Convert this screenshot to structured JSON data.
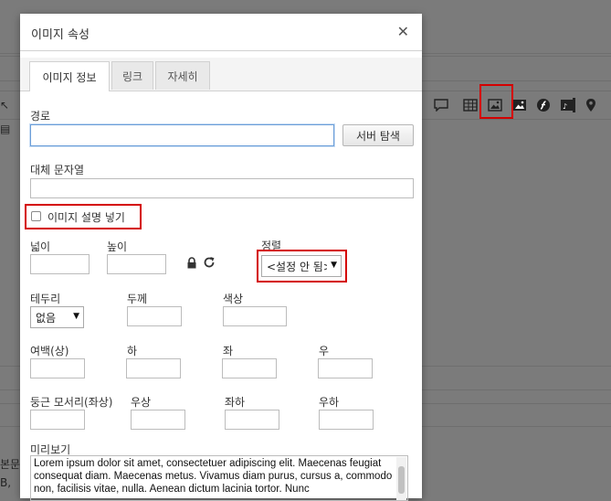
{
  "dialog": {
    "title": "이미지 속성",
    "close_label": "✕",
    "tabs": [
      {
        "label": "이미지 정보"
      },
      {
        "label": "링크"
      },
      {
        "label": "자세히"
      }
    ]
  },
  "form": {
    "path_label": "경로",
    "path_value": "",
    "browse_button": "서버 탐색",
    "alt_label": "대체 문자열",
    "alt_value": "",
    "caption_label": "이미지 설명 넣기",
    "width_label": "넓이",
    "height_label": "높이",
    "align_label": "정렬",
    "align_value": "<설정 안 됨>",
    "border_label": "테두리",
    "border_value": "없음",
    "thickness_label": "두께",
    "color_label": "색상",
    "margin_top_label": "여백(상)",
    "margin_bottom_label": "하",
    "margin_left_label": "좌",
    "margin_right_label": "우",
    "radius_tl_label": "둥근 모서리(좌상)",
    "radius_tr_label": "우상",
    "radius_bl_label": "좌하",
    "radius_br_label": "우하",
    "preview_label": "미리보기",
    "preview_text": "Lorem ipsum dolor sit amet, consectetuer adipiscing elit. Maecenas feugiat consequat diam. Maecenas metus. Vivamus diam purus, cursus a, commodo non, facilisis vitae, nulla. Aenean dictum lacinia tortor. Nunc"
  },
  "background": {
    "text_line1": "본문",
    "text_line2": "B,",
    "toolbar_icons": [
      "table-icon",
      "image-icon",
      "image2-icon",
      "flash-icon",
      "video-icon",
      "map-pin-icon"
    ]
  },
  "colors": {
    "highlight": "#d40000",
    "focus_border": "#6b9ed8",
    "overlay": "#7b7b7b"
  }
}
